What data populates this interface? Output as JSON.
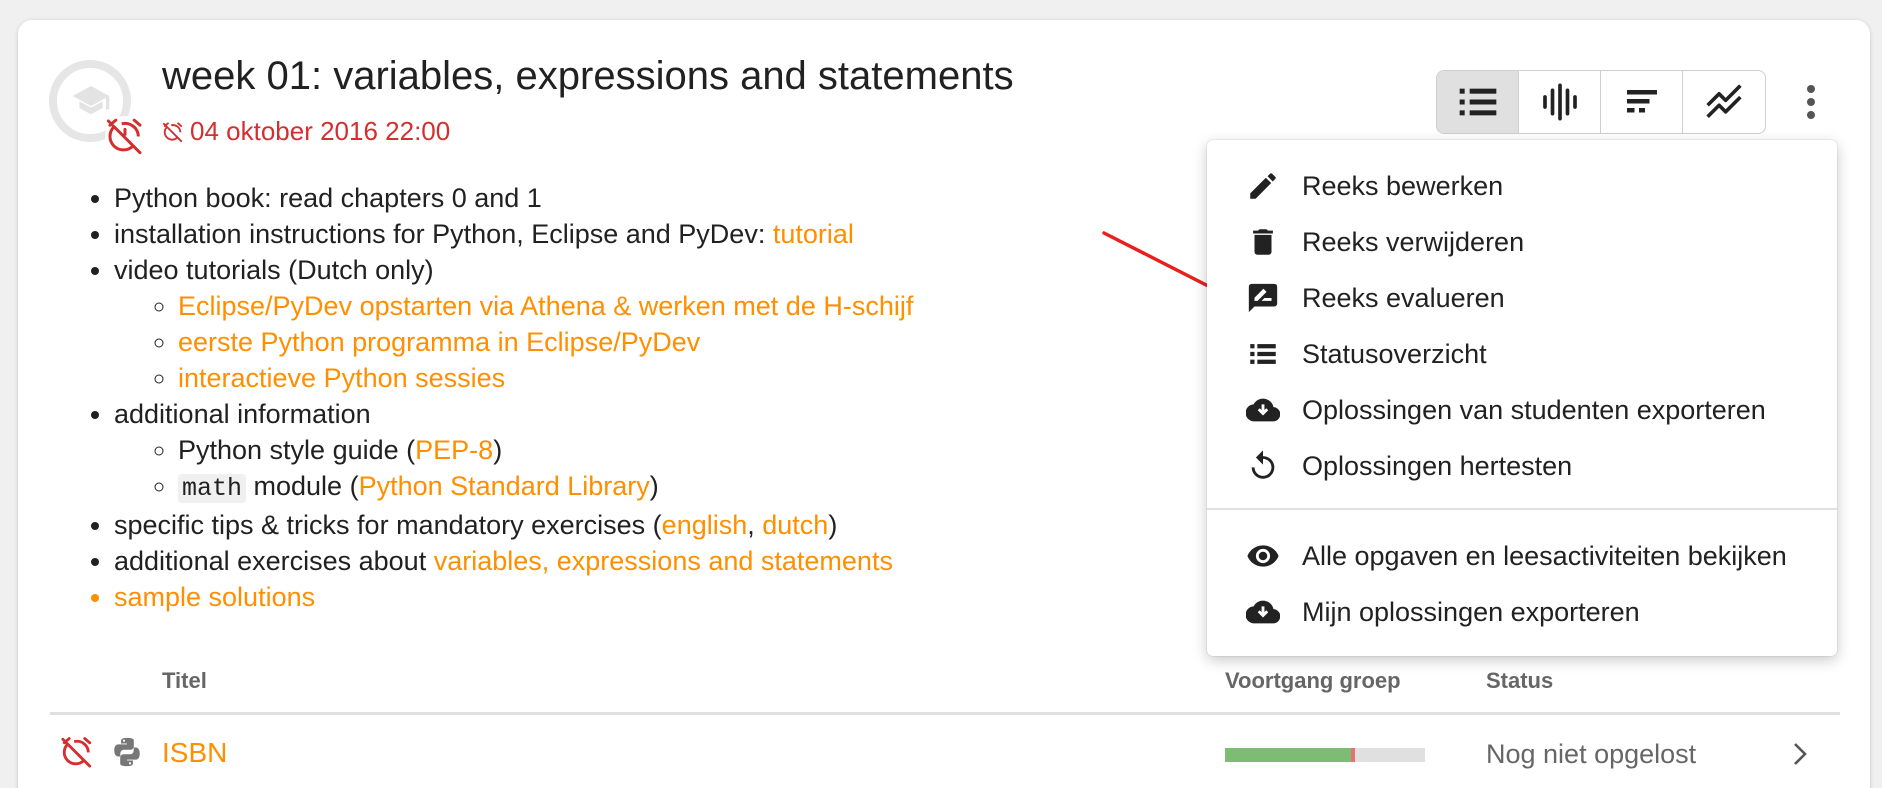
{
  "series": {
    "title": "week 01: variables, expressions and statements",
    "deadline": "04 oktober 2016 22:00"
  },
  "view_toggle": {
    "buttons": [
      "list-icon",
      "timeline-icon",
      "bars-icon",
      "trend-icon"
    ],
    "active_index": 0
  },
  "description": {
    "items": {
      "book": "Python book: read chapters 0 and 1",
      "install_prefix": "installation instructions for Python, Eclipse and PyDev: ",
      "install_link": "tutorial",
      "video": "video tutorials (Dutch only)",
      "video_links": [
        "Eclipse/PyDev opstarten via Athena & werken met de H-schijf",
        "eerste Python programma in Eclipse/PyDev",
        "interactieve Python sessies"
      ],
      "additional": "additional information",
      "style_prefix": "Python style guide (",
      "style_link": "PEP-8",
      "style_suffix": ")",
      "math_code": "math",
      "math_prefix": " module (",
      "math_link": "Python Standard Library",
      "math_suffix": ")",
      "tips_prefix": "specific tips & tricks for mandatory exercises (",
      "tips_link1": "english",
      "tips_sep": ", ",
      "tips_link2": "dutch",
      "tips_suffix": ")",
      "extra_prefix": "additional exercises about ",
      "extra_link": "variables, expressions and statements",
      "solutions_link": "sample solutions"
    }
  },
  "table": {
    "headers": {
      "title": "Titel",
      "progress": "Voortgang groep",
      "status": "Status"
    },
    "rows": [
      {
        "name": "ISBN",
        "status": "Nog niet opgelost",
        "progress_correct": 0.63,
        "progress_wrong": 0.02
      }
    ]
  },
  "menu": {
    "items": [
      {
        "label": "Reeks bewerken",
        "icon": "pencil-icon"
      },
      {
        "label": "Reeks verwijderen",
        "icon": "trash-icon"
      },
      {
        "label": "Reeks evalueren",
        "icon": "evaluate-icon"
      },
      {
        "label": "Statusoverzicht",
        "icon": "list-icon"
      },
      {
        "label": "Oplossingen van studenten exporteren",
        "icon": "cloud-download-icon"
      },
      {
        "label": "Oplossingen hertesten",
        "icon": "restart-icon"
      },
      {
        "label": "Alle opgaven en leesactiviteiten bekijken",
        "icon": "eye-icon"
      },
      {
        "label": "Mijn oplossingen exporteren",
        "icon": "cloud-download-icon"
      }
    ]
  },
  "colors": {
    "accent_link": "#ff8f00",
    "deadline_red": "#d32f2f",
    "progress_ok": "#7cbd73",
    "progress_wrong": "#e57373",
    "annotation_arrow": "#e8201c"
  }
}
